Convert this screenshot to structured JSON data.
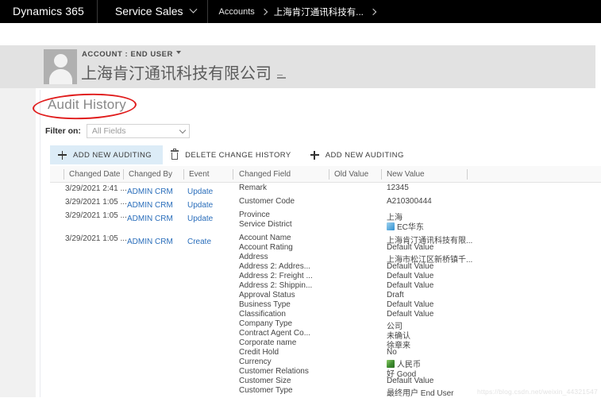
{
  "topnav": {
    "brand": "Dynamics 365",
    "app": "Service Sales",
    "app_chevron_icon": "chevron-down-icon",
    "breadcrumb": [
      {
        "label": "Accounts"
      },
      {
        "label": "上海肯汀通讯科技有..."
      }
    ]
  },
  "record_header": {
    "kicker": "ACCOUNT : END USER",
    "kicker_caret_icon": "caret-down-icon",
    "title": "上海肯汀通讯科技有限公司",
    "title_menu_icon": "more-lines-icon",
    "avatar_icon": "person-avatar"
  },
  "section": {
    "title": "Audit History",
    "annotation": {
      "shape": "ellipse",
      "color": "#e01b1b"
    }
  },
  "filter": {
    "label": "Filter on:",
    "value": "All Fields",
    "placeholder": "All Fields",
    "chevron_icon": "chevron-down-icon",
    "options": [
      "All Fields"
    ]
  },
  "commands": [
    {
      "id": "add-new-auditing-1",
      "label": "ADD NEW AUDITING",
      "icon": "plus-icon",
      "active": true
    },
    {
      "id": "delete-change-history",
      "label": "DELETE CHANGE HISTORY",
      "icon": "trash-icon",
      "active": false
    },
    {
      "id": "add-new-auditing-2",
      "label": "ADD NEW AUDITING",
      "icon": "plus-icon",
      "active": false
    }
  ],
  "grid": {
    "columns": [
      {
        "key": "changed_date",
        "label": "Changed Date"
      },
      {
        "key": "changed_by",
        "label": "Changed By"
      },
      {
        "key": "event",
        "label": "Event"
      },
      {
        "key": "changed_field",
        "label": "Changed Field"
      },
      {
        "key": "old_value",
        "label": "Old Value"
      },
      {
        "key": "new_value",
        "label": "New Value"
      }
    ],
    "rows": [
      {
        "changed_date": "3/29/2021 2:41 ...",
        "changed_by": "ADMIN CRM",
        "event": "Update",
        "changes": [
          {
            "field": "Remark",
            "old": "",
            "new": "12345"
          }
        ]
      },
      {
        "changed_date": "3/29/2021 1:05 ...",
        "changed_by": "ADMIN CRM",
        "event": "Update",
        "changes": [
          {
            "field": "Customer Code",
            "old": "",
            "new": "A210300444"
          }
        ]
      },
      {
        "changed_date": "3/29/2021 1:05 ...",
        "changed_by": "ADMIN CRM",
        "event": "Update",
        "changes": [
          {
            "field": "Province",
            "old": "",
            "new": "上海"
          },
          {
            "field": "Service District",
            "old": "",
            "new": "EC华东",
            "new_icon": "lookup-blue-icon"
          }
        ]
      },
      {
        "changed_date": "3/29/2021 1:05 ...",
        "changed_by": "ADMIN CRM",
        "event": "Create",
        "changes": [
          {
            "field": "Account Name",
            "old": "",
            "new": "上海肯汀通讯科技有限..."
          },
          {
            "field": "Account Rating",
            "old": "",
            "new": "Default Value"
          },
          {
            "field": "Address",
            "old": "",
            "new": "上海市松江区新桥镇千..."
          },
          {
            "field": "Address 2: Addres...",
            "old": "",
            "new": "Default Value"
          },
          {
            "field": "Address 2: Freight ...",
            "old": "",
            "new": "Default Value"
          },
          {
            "field": "Address 2: Shippin...",
            "old": "",
            "new": "Default Value"
          },
          {
            "field": "Approval Status",
            "old": "",
            "new": "Draft"
          },
          {
            "field": "Business Type",
            "old": "",
            "new": "Default Value"
          },
          {
            "field": "Classification",
            "old": "",
            "new": "Default Value"
          },
          {
            "field": "Company Type",
            "old": "",
            "new": "公司"
          },
          {
            "field": "Contract Agent Co...",
            "old": "",
            "new": "未确认"
          },
          {
            "field": "Corporate name",
            "old": "",
            "new": "徐章来"
          },
          {
            "field": "Credit Hold",
            "old": "",
            "new": "No"
          },
          {
            "field": "Currency",
            "old": "",
            "new": "人民币",
            "new_icon": "currency-green-icon"
          },
          {
            "field": "Customer Relations",
            "old": "",
            "new": "好 Good"
          },
          {
            "field": "Customer Size",
            "old": "",
            "new": "Default Value"
          },
          {
            "field": "Customer Type",
            "old": "",
            "new": "最终用户 End User"
          }
        ]
      }
    ]
  },
  "watermark": "https://blog.csdn.net/weixin_44321547"
}
